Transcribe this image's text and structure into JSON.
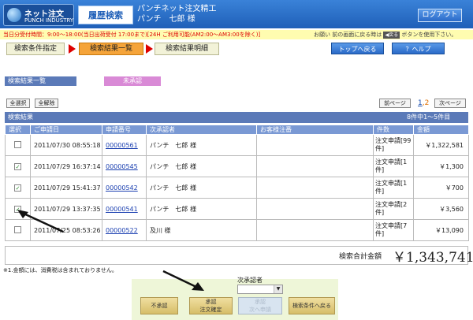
{
  "header": {
    "logo_line1": "ネット注文",
    "logo_line2": "PUNCH INDUSTRY",
    "history": "履歴検索",
    "company": "パンチネット注文精工",
    "user": "パンチ　七郎 様",
    "logout": "ログアウト"
  },
  "notice": {
    "left": "当日分受付時間：9:00～18:00(当日出荷受付 17:00まで)[24H ご利用可能(AM2:00～AM3:00を除く)]",
    "right_pre": "お願い 前の画面に戻る時は",
    "back": "◀戻る",
    "right_post": "ボタンを使用下さい。"
  },
  "steps": {
    "s1": "検索条件指定",
    "s2": "検索結果一覧",
    "s3": "検索結果明細"
  },
  "nav": {
    "top": "トップへ戻る",
    "help": "？ヘルプ"
  },
  "section": {
    "title": "検索結果一覧",
    "pending": "未承認"
  },
  "controls": {
    "select_all": "全選択",
    "deselect_all": "全解除",
    "prev": "前ページ",
    "page1": "1",
    "page2": "2",
    "next": "次ページ"
  },
  "results": {
    "label": "検索結果",
    "count": "8件中1～5件目"
  },
  "table": {
    "headers": [
      "選択",
      "ご申請日",
      "申請番号",
      "次承認者",
      "お客様注番",
      "件数",
      "金額"
    ],
    "rows": [
      {
        "checked": "",
        "date": "2011/07/30 08:55:18",
        "no": "00000561",
        "approver": "パンチ　七郎 様",
        "order": "",
        "qty": "注文申請[99件]",
        "amount": "￥1,322,581"
      },
      {
        "checked": "✓",
        "date": "2011/07/29 16:37:14",
        "no": "00000545",
        "approver": "パンチ　七郎 様",
        "order": "",
        "qty": "注文申請[1件]",
        "amount": "￥1,300"
      },
      {
        "checked": "✓",
        "date": "2011/07/29 15:41:37",
        "no": "00000542",
        "approver": "パンチ　七郎 様",
        "order": "",
        "qty": "注文申請[1件]",
        "amount": "￥700"
      },
      {
        "checked": "✓",
        "date": "2011/07/29 13:37:35",
        "no": "00000541",
        "approver": "パンチ　七郎 様",
        "order": "",
        "qty": "注文申請[2件]",
        "amount": "￥3,560"
      },
      {
        "checked": "",
        "date": "2011/07/25 08:53:26",
        "no": "00000522",
        "approver": "及川 様",
        "order": "",
        "qty": "注文申請[7件]",
        "amount": "￥13,090"
      }
    ]
  },
  "total": {
    "label": "検索合計金額",
    "value": "￥1,343,741"
  },
  "note": "※1.金額には、消費税は含まれておりません。",
  "actions": {
    "next_label": "次承認者",
    "reject": "不承認",
    "approve_l1": "承認",
    "approve_l2": "注文確定",
    "approve_next_l1": "承認",
    "approve_next_l2": "次へ申請",
    "back_search": "検索条件へ戻る"
  }
}
